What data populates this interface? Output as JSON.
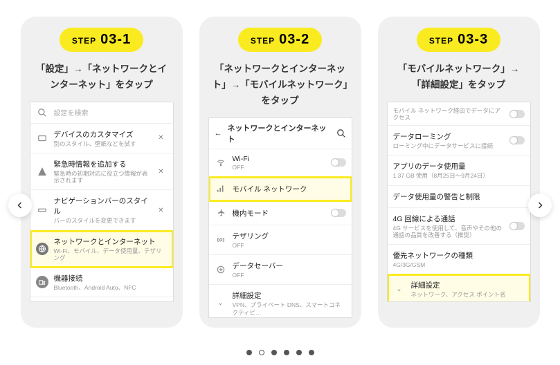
{
  "steps": [
    {
      "label": "STEP",
      "num": "03-1",
      "instruction": "「設定」→「ネットワークとインターネット」をタップ",
      "search_placeholder": "設定を検索",
      "items": [
        {
          "title": "デバイスのカスタマイズ",
          "sub": "別のスタイル、壁紙などを試す"
        },
        {
          "title": "緊急時情報を追加する",
          "sub": "緊急時の初期対応に役立つ情報が表示されます"
        },
        {
          "title": "ナビゲーションバーのスタイル",
          "sub": "バーのスタイルを変更できます"
        },
        {
          "title": "ネットワークとインターネット",
          "sub": "Wi-Fi、モバイル、データ使用量、テザリング",
          "highlight": true,
          "icon": "globe"
        },
        {
          "title": "機器接続",
          "sub": "Bluetooth、Android Auto、NFC",
          "icon": "devices"
        }
      ]
    },
    {
      "label": "STEP",
      "num": "03-2",
      "instruction": "「ネットワークとインターネット」→「モバイルネットワーク」をタップ",
      "header": "ネットワークとインターネット",
      "items": [
        {
          "title": "Wi-Fi",
          "sub": "OFF",
          "icon": "wifi",
          "toggle": true
        },
        {
          "title": "モバイル ネットワーク",
          "icon": "signal",
          "highlight": true
        },
        {
          "title": "機内モード",
          "icon": "plane",
          "toggle": true
        },
        {
          "title": "テザリング",
          "sub": "OFF",
          "icon": "tether"
        },
        {
          "title": "データセーバー",
          "sub": "OFF",
          "icon": "datasaver"
        },
        {
          "title": "詳細設定",
          "sub": "VPN、プライベート DNS、スマートコネクティビ…",
          "icon": "chevron-down"
        }
      ]
    },
    {
      "label": "STEP",
      "num": "03-3",
      "instruction": "「モバイルネットワーク」→「詳細設定」をタップ",
      "items": [
        {
          "sub": "モバイル ネットワーク経由でデータにアクセス",
          "toggle": true
        },
        {
          "title": "データローミング",
          "sub": "ローミング中にデータサービスに接続",
          "toggle": true
        },
        {
          "title": "アプリのデータ使用量",
          "sub": "1.37 GB 使用（8月25日～9月24日）"
        },
        {
          "title": "データ使用量の警告と制限"
        },
        {
          "title": "4G 回線による通話",
          "sub": "4G サービスを使用して、音声やその他の通話の品質を改善する（推奨）",
          "toggle": true
        },
        {
          "title": "優先ネットワークの種類",
          "sub": "4G/3G/GSM"
        },
        {
          "title": "詳細設定",
          "sub": "ネットワーク、アクセス ポイント名",
          "icon": "chevron-down",
          "highlight": true
        }
      ]
    }
  ],
  "dots_count": 6,
  "active_dot": 1
}
